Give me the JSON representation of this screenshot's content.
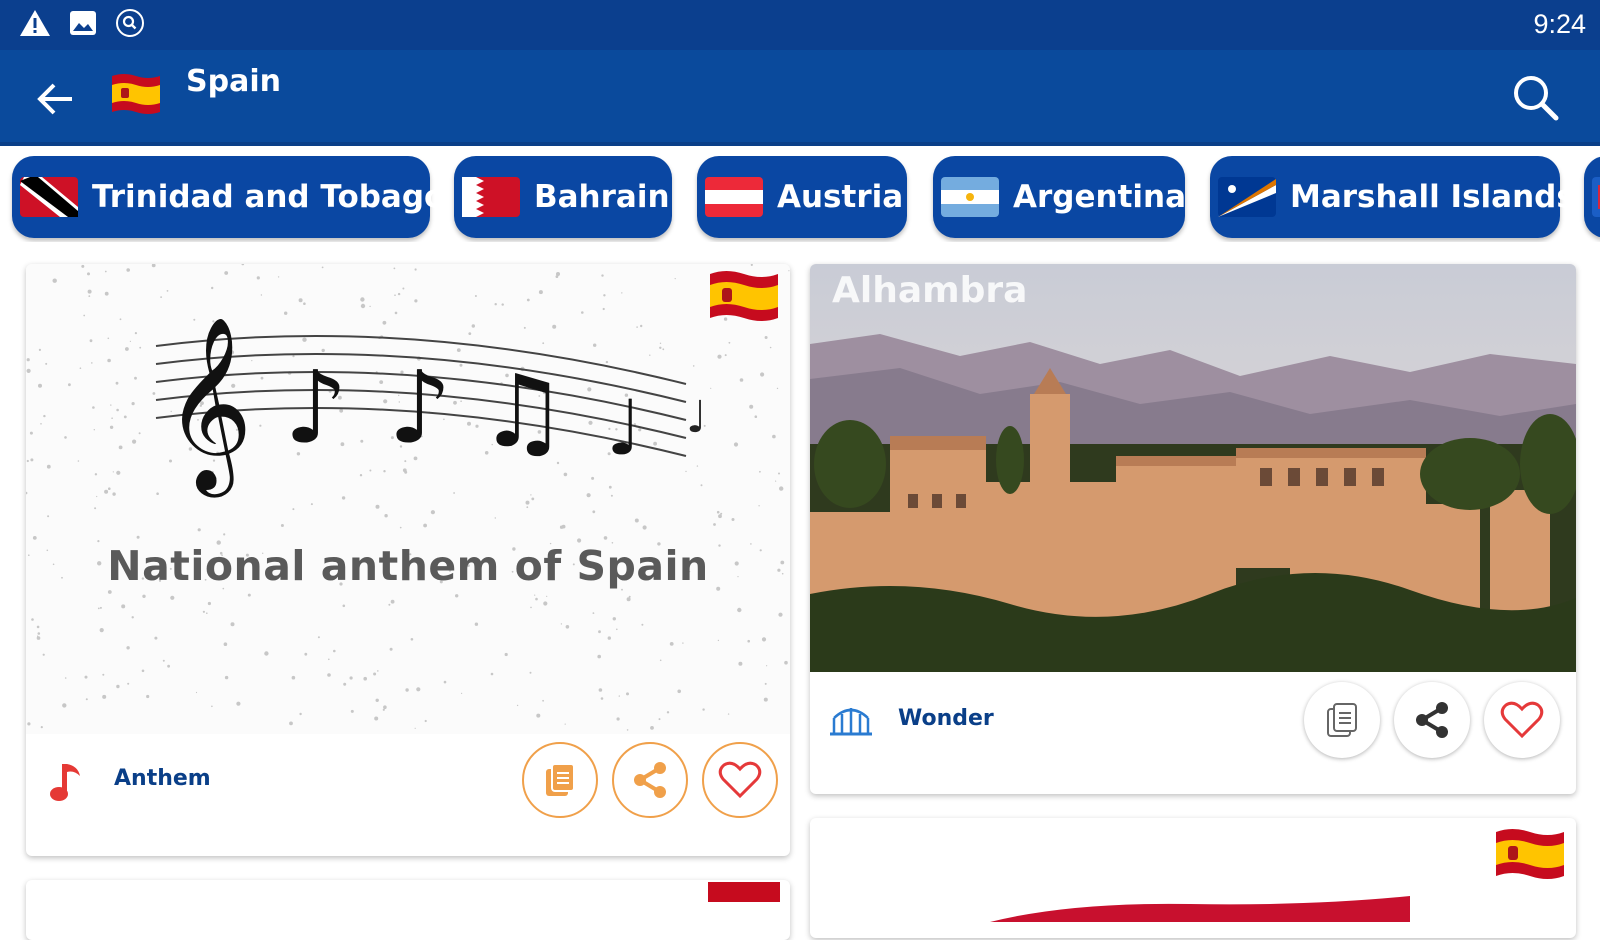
{
  "status_bar": {
    "time": "9:24",
    "icons": [
      "warning-icon",
      "image-icon",
      "search-notification-icon"
    ]
  },
  "app_bar": {
    "title": "Spain",
    "back_icon": "arrow-left-icon",
    "search_icon": "search-icon"
  },
  "country_chips": [
    {
      "label": "Trinidad and Tobago",
      "flag": "trinidad-and-tobago-flag-icon"
    },
    {
      "label": "Bahrain",
      "flag": "bahrain-flag-icon"
    },
    {
      "label": "Austria",
      "flag": "austria-flag-icon"
    },
    {
      "label": "Argentina",
      "flag": "argentina-flag-icon"
    },
    {
      "label": "Marshall Islands",
      "flag": "marshall-islands-flag-icon"
    }
  ],
  "cards": {
    "anthem": {
      "image_text": "National anthem of Spain",
      "category_icon": "music-note-icon",
      "category": "Anthem",
      "actions": [
        "copy-icon",
        "share-icon",
        "heart-icon"
      ]
    },
    "wonder": {
      "title": "Alhambra",
      "category_icon": "monument-icon",
      "category": "Wonder",
      "actions": [
        "copy-icon",
        "share-icon",
        "heart-icon"
      ]
    }
  },
  "colors": {
    "status_bar": "#0b3f8e",
    "app_bar": "#0a4a9c",
    "chip": "#0a47a3",
    "accent_orange": "#f0a04a",
    "heart_red": "#e5393a"
  }
}
